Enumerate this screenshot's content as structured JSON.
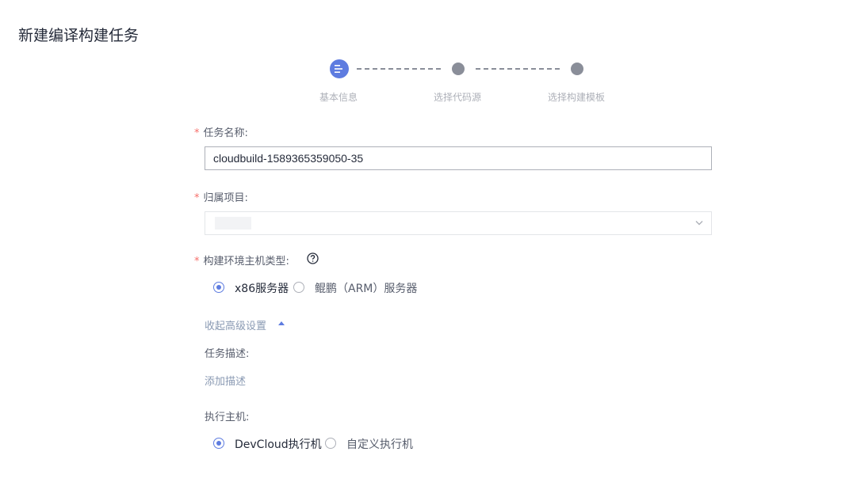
{
  "page_title": "新建编译构建任务",
  "steps": [
    {
      "label": "基本信息",
      "state": "active"
    },
    {
      "label": "选择代码源",
      "state": "pending"
    },
    {
      "label": "选择构建模板",
      "state": "pending"
    }
  ],
  "form": {
    "required_mark": "*",
    "task_name": {
      "label": "任务名称:",
      "value": "cloudbuild-1589365359050-35"
    },
    "project": {
      "label": "归属项目:",
      "value": ""
    },
    "host_type": {
      "label": "构建环境主机类型:",
      "options": [
        {
          "label": "x86服务器",
          "checked": true
        },
        {
          "label": "鲲鹏（ARM）服务器",
          "checked": false
        }
      ]
    },
    "collapse_advanced": "收起高级设置",
    "description": {
      "label": "任务描述:",
      "add_link": "添加描述"
    },
    "executor": {
      "label": "执行主机:",
      "options": [
        {
          "label": "DevCloud执行机",
          "checked": true
        },
        {
          "label": "自定义执行机",
          "checked": false
        }
      ]
    }
  },
  "colors": {
    "accent": "#5e7ce0",
    "required": "#f66f6a",
    "pending_step": "#8a8e99"
  }
}
